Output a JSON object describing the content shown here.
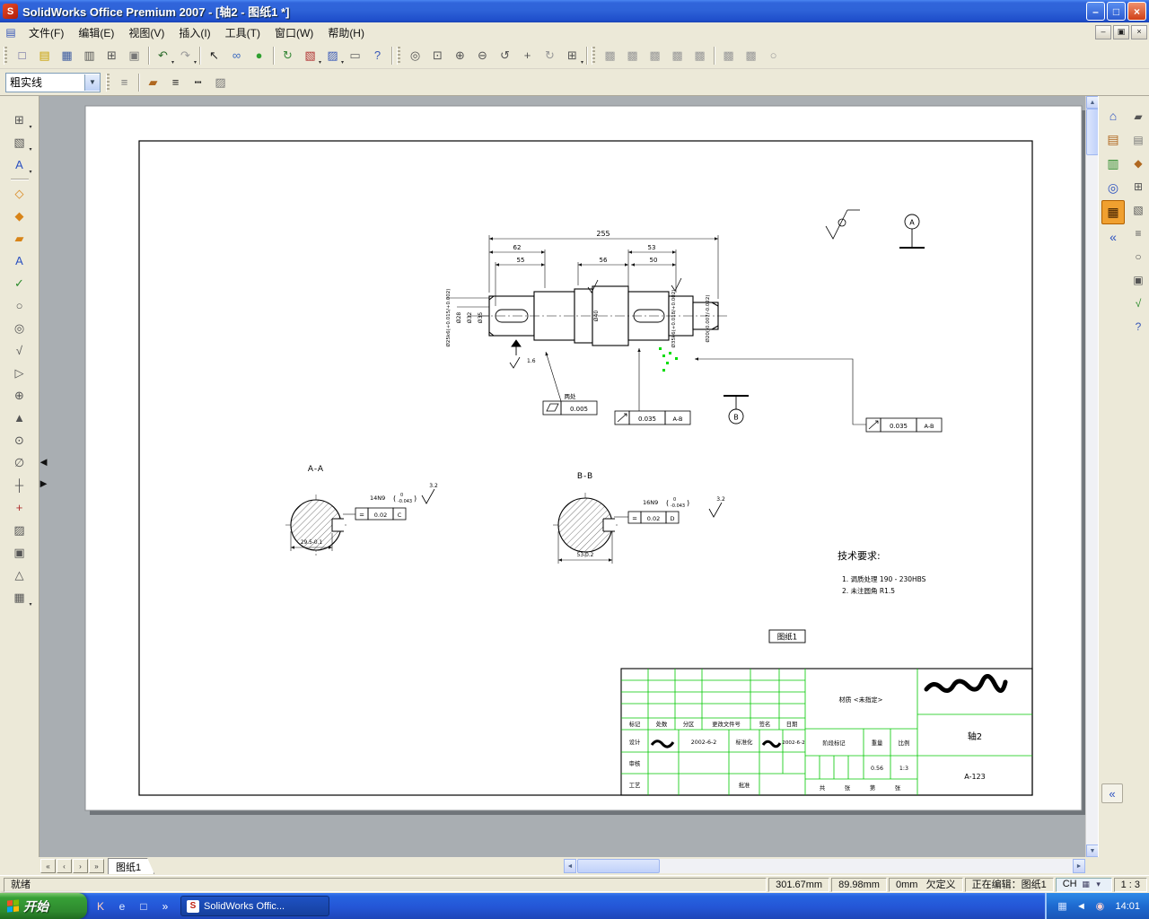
{
  "window": {
    "title": "SolidWorks Office Premium 2007 - [轴2 - 图纸1 *]",
    "controls": {
      "minimize": "–",
      "maximize": "□",
      "close": "×"
    }
  },
  "menu": {
    "items": [
      "文件(F)",
      "编辑(E)",
      "视图(V)",
      "插入(I)",
      "工具(T)",
      "窗口(W)",
      "帮助(H)"
    ],
    "child_controls": {
      "minimize": "–",
      "restore": "▣",
      "close": "×"
    }
  },
  "colors": {
    "titlebar": "#2E63D8",
    "taskbar": "#2456D6",
    "start_green": "#37A037",
    "titleblock_green": "#00C800",
    "selection_green": "#00DC00",
    "taskpane_highlight": "#F0A030"
  },
  "toolbars": {
    "line_style": "粗实线",
    "row1": [
      {
        "grip": 1
      },
      {
        "n": "new-icon",
        "g": "□",
        "c": "#5a5a9a"
      },
      {
        "n": "open-icon",
        "g": "▤",
        "c": "#c8a000"
      },
      {
        "n": "save-icon",
        "g": "▦",
        "c": "#3a5aa0"
      },
      {
        "n": "print-icon",
        "g": "▥",
        "c": "#555"
      },
      {
        "n": "print-preview-icon",
        "g": "⊞",
        "c": "#555"
      },
      {
        "n": "copy-icon",
        "g": "▣",
        "c": "#777"
      },
      {
        "sep": 1
      },
      {
        "n": "undo-icon",
        "g": "↶",
        "c": "#2a6a2a",
        "dd": 1
      },
      {
        "n": "redo-icon",
        "g": "↷",
        "c": "#999",
        "dd": 1
      },
      {
        "sep": 1
      },
      {
        "n": "select-icon",
        "g": "↖",
        "c": "#222"
      },
      {
        "n": "hyperlink-icon",
        "g": "∞",
        "c": "#3a6ac0"
      },
      {
        "n": "stoplight-icon",
        "g": "●",
        "c": "#30a030"
      },
      {
        "sep": 1
      },
      {
        "n": "rebuild-icon",
        "g": "↻",
        "c": "#3a8a3a"
      },
      {
        "n": "make-drawing-icon",
        "g": "▧",
        "c": "#b03030",
        "dd": 1
      },
      {
        "n": "make-assembly-icon",
        "g": "▨",
        "c": "#3858b8",
        "dd": 1
      },
      {
        "n": "sheet-properties-icon",
        "g": "▭",
        "c": "#666"
      },
      {
        "n": "help-icon",
        "g": "?",
        "c": "#3858b8"
      },
      {
        "sep": 1
      },
      {
        "grip": 1
      },
      {
        "n": "zoom-fit-icon",
        "g": "◎",
        "c": "#555"
      },
      {
        "n": "zoom-area-icon",
        "g": "⊡",
        "c": "#555"
      },
      {
        "n": "zoom-in-out-icon",
        "g": "⊕",
        "c": "#555"
      },
      {
        "n": "zoom-selection-icon",
        "g": "⊖",
        "c": "#555"
      },
      {
        "n": "refresh-view-icon",
        "g": "↺",
        "c": "#555"
      },
      {
        "n": "pan-icon",
        "g": "+",
        "c": "#555"
      },
      {
        "n": "rotate-view-icon",
        "g": "↻",
        "c": "#999"
      },
      {
        "n": "view-orientation-icon",
        "g": "⊞",
        "c": "#555",
        "dd": 1
      },
      {
        "sep": 1
      },
      {
        "grip": 1
      },
      {
        "n": "shaded-icon",
        "g": "▩",
        "c": "#9a9a9a"
      },
      {
        "n": "wireframe-icon",
        "g": "▩",
        "c": "#9a9a9a"
      },
      {
        "n": "hidden-lines-icon",
        "g": "▩",
        "c": "#9a9a9a"
      },
      {
        "n": "hlr-icon",
        "g": "▩",
        "c": "#9a9a9a"
      },
      {
        "n": "perspective-icon",
        "g": "▩",
        "c": "#9a9a9a"
      },
      {
        "sep": 1
      },
      {
        "n": "section-view-icon",
        "g": "▩",
        "c": "#9a9a9a"
      },
      {
        "n": "curvature-icon",
        "g": "▩",
        "c": "#9a9a9a"
      },
      {
        "n": "draft-analysis-icon",
        "g": "○",
        "c": "#9a9a9a"
      }
    ],
    "row2": [
      {
        "grip": 1
      },
      {
        "n": "layer-properties-icon",
        "g": "≡",
        "c": "#777"
      },
      {
        "sep": 1
      },
      {
        "n": "line-color-icon",
        "g": "▰",
        "c": "#b06820"
      },
      {
        "n": "line-thickness-icon",
        "g": "≡",
        "c": "#222"
      },
      {
        "n": "line-style-icon",
        "g": "┅",
        "c": "#222"
      },
      {
        "n": "hide-show-edges-icon",
        "g": "▨",
        "c": "#777"
      }
    ]
  },
  "left_toolbar": [
    {
      "n": "view-layout-icon",
      "g": "⊞",
      "c": "#555",
      "dd": 1
    },
    {
      "n": "hatch-pattern-icon",
      "g": "▧",
      "c": "#555",
      "dd": 1
    },
    {
      "n": "text-format-icon",
      "g": "A",
      "c": "#2a50c0",
      "dd": 1
    },
    {
      "sep": 1
    },
    {
      "n": "smart-dimension-icon",
      "g": "◇",
      "c": "#d88418"
    },
    {
      "n": "model-items-icon",
      "g": "◆",
      "c": "#d88418"
    },
    {
      "n": "format-painter-icon",
      "g": "▰",
      "c": "#d88418"
    },
    {
      "n": "note-icon",
      "g": "A",
      "c": "#2a50c0"
    },
    {
      "n": "spell-check-icon",
      "g": "✓",
      "c": "#2a8a2a"
    },
    {
      "n": "balloon-icon",
      "g": "○",
      "c": "#555"
    },
    {
      "n": "auto-balloon-icon",
      "g": "◎",
      "c": "#555"
    },
    {
      "n": "surface-finish-icon",
      "g": "√",
      "c": "#555"
    },
    {
      "n": "weld-symbol-icon",
      "g": "▷",
      "c": "#555"
    },
    {
      "n": "geometric-tolerance-icon",
      "g": "⊕",
      "c": "#555"
    },
    {
      "n": "datum-feature-icon",
      "g": "▲",
      "c": "#555"
    },
    {
      "n": "datum-target-icon",
      "g": "⊙",
      "c": "#555"
    },
    {
      "n": "hole-callout-icon",
      "g": "∅",
      "c": "#555"
    },
    {
      "n": "centerline-icon",
      "g": "┼",
      "c": "#555"
    },
    {
      "n": "center-mark-icon",
      "g": "+",
      "c": "#b03030"
    },
    {
      "n": "area-hatch-icon",
      "g": "▨",
      "c": "#555"
    },
    {
      "n": "block-icon",
      "g": "▣",
      "c": "#555"
    },
    {
      "n": "revision-symbol-icon",
      "g": "△",
      "c": "#555"
    },
    {
      "n": "tables-icon",
      "g": "▦",
      "c": "#555",
      "dd": 1
    }
  ],
  "taskpane": {
    "col1": [
      {
        "n": "sw-resources-icon",
        "g": "⌂",
        "c": "#2a50c0"
      },
      {
        "n": "design-library-icon",
        "g": "▤",
        "c": "#b06820"
      },
      {
        "n": "file-explorer-icon",
        "g": "▥",
        "c": "#2a8a2a"
      },
      {
        "n": "search-icon",
        "g": "◎",
        "c": "#2a50c0"
      },
      {
        "n": "view-palette-icon",
        "g": "▦",
        "c": "#402000",
        "cls": "active"
      },
      {
        "n": "collapse-taskpane-icon",
        "g": "«",
        "c": "#2a50c0"
      }
    ],
    "col2": [
      {
        "n": "tools-pane-icon",
        "g": "▰",
        "c": "#555"
      },
      {
        "n": "library2-icon",
        "g": "▤",
        "c": "#777"
      },
      {
        "n": "materials-icon",
        "g": "◆",
        "c": "#b06820"
      },
      {
        "n": "grid-pane-icon",
        "g": "⊞",
        "c": "#555"
      },
      {
        "n": "hatch-pane-icon",
        "g": "▧",
        "c": "#555"
      },
      {
        "n": "list-pane-icon",
        "g": "≡",
        "c": "#555"
      },
      {
        "n": "circle-tool-icon",
        "g": "○",
        "c": "#555"
      },
      {
        "n": "block-pane-icon",
        "g": "▣",
        "c": "#555"
      },
      {
        "n": "check-pane-icon",
        "g": "√",
        "c": "#2a8a2a"
      },
      {
        "n": "help-pane-icon",
        "g": "?",
        "c": "#3858b8"
      }
    ],
    "collapse_bottom": "«"
  },
  "scrollbars": {
    "up": "▲",
    "down": "▼",
    "left": "◄",
    "right": "►"
  },
  "splitter": [
    {
      "n": "splitter-left-icon",
      "g": "◄",
      "c": "#111"
    },
    {
      "n": "splitter-right-icon",
      "g": "►",
      "c": "#111"
    }
  ],
  "sheet_nav": [
    {
      "n": "first-sheet-button",
      "g": "«",
      "c": "#333",
      "cls": "navbtn"
    },
    {
      "n": "prev-sheet-button",
      "g": "‹",
      "c": "#333",
      "cls": "navbtn"
    },
    {
      "n": "next-sheet-button",
      "g": "›",
      "c": "#333",
      "cls": "navbtn"
    },
    {
      "n": "last-sheet-button",
      "g": "»",
      "c": "#333",
      "cls": "navbtn"
    }
  ],
  "sheet_tabs": {
    "active": "图纸1"
  },
  "drawing": {
    "dims": {
      "overall": "255",
      "d62": "62",
      "d55": "55",
      "d53": "53",
      "d56": "56",
      "d50": "50"
    },
    "dia_labels": [
      "Ø25k6(+0.015/+0.002)",
      "Ø28",
      "Ø32",
      "Ø35",
      "Ø40",
      "Ø35k6(+0.018/+0.002)",
      "Ø20(-0.007/-0.022)"
    ],
    "roughness": {
      "r16": "1.6",
      "r32a": "3.2",
      "r32b": "3.2"
    },
    "frames": {
      "flatness": {
        "note": "两处",
        "value": "0.005"
      },
      "runout1": {
        "value": "0.035",
        "datum": "A-B"
      },
      "runout2": {
        "value": "0.035",
        "datum": "A-B"
      },
      "sym1": {
        "symbol": "=",
        "value": "0.02",
        "datum": "C"
      },
      "sym2": {
        "symbol": "=",
        "value": "0.02",
        "datum": "D"
      }
    },
    "datums": {
      "a": "A",
      "b": "B"
    },
    "sectionA": {
      "label": "A-A",
      "key": "14N9",
      "paren_open": "(",
      "tol_top": "0",
      "tol_bottom": "-0.043",
      "paren_close": ")",
      "depth": "29.5-0.1"
    },
    "sectionB": {
      "label": "B-B",
      "key": "16N9",
      "paren_open": "(",
      "tol_top": "0",
      "tol_bottom": "-0.043",
      "paren_close": ")",
      "depth": "53-0.2"
    },
    "tech": {
      "title": "技术要求:",
      "line1": "1.  调质处理 190 - 230HBS",
      "line2": "2.  未注圆角 R1.5"
    },
    "sheet_label": "图纸1",
    "titleblock": {
      "header": [
        "标记",
        "处数",
        "分区",
        "更改文件号",
        "签名",
        "日期"
      ],
      "design": "设计",
      "date1": "2002-6-2",
      "standard": "标准化",
      "date2": "2002-6-2",
      "check": "审核",
      "craft": "工艺",
      "approve": "批准",
      "material": "材质 <未指定>",
      "stage": "阶段标记",
      "weight_label": "重量",
      "scale_label": "比例",
      "weight": "0.56",
      "scale": "1:3",
      "pages": [
        "共",
        "张",
        "第",
        "张"
      ],
      "part_name": "轴2",
      "part_code": "A-123"
    }
  },
  "statusbar": {
    "ready": "就绪",
    "x": "301.67mm",
    "y": "89.98mm",
    "z": "0mm",
    "state": "欠定义",
    "editing": "正在编辑：图纸1",
    "lang": "CH",
    "lang_icons": [
      {
        "n": "keyboard-layout-icon",
        "g": "▦",
        "c": "#446"
      },
      {
        "n": "lang-options-icon",
        "g": "▾",
        "c": "#446"
      }
    ],
    "scale": "1 : 3"
  },
  "taskbar": {
    "start": "开始",
    "quick_launch": [
      {
        "n": "ql-app-icon",
        "g": "K",
        "c": "#ffd0c0"
      },
      {
        "n": "ie-icon",
        "g": "e",
        "c": "#d8e8ff"
      },
      {
        "n": "show-desktop-icon",
        "g": "□",
        "c": "#fff"
      },
      {
        "n": "ql-expand-icon",
        "g": "»",
        "c": "#fff"
      }
    ],
    "task": "SolidWorks Offic...",
    "tray": [
      {
        "n": "tray-display-icon",
        "g": "▦",
        "c": "#cfe0ff"
      },
      {
        "n": "tray-volume-icon",
        "g": "◄",
        "c": "#fff"
      },
      {
        "n": "tray-safety-icon",
        "g": "◉",
        "c": "#ffd0d0"
      }
    ],
    "clock": "14:01"
  }
}
